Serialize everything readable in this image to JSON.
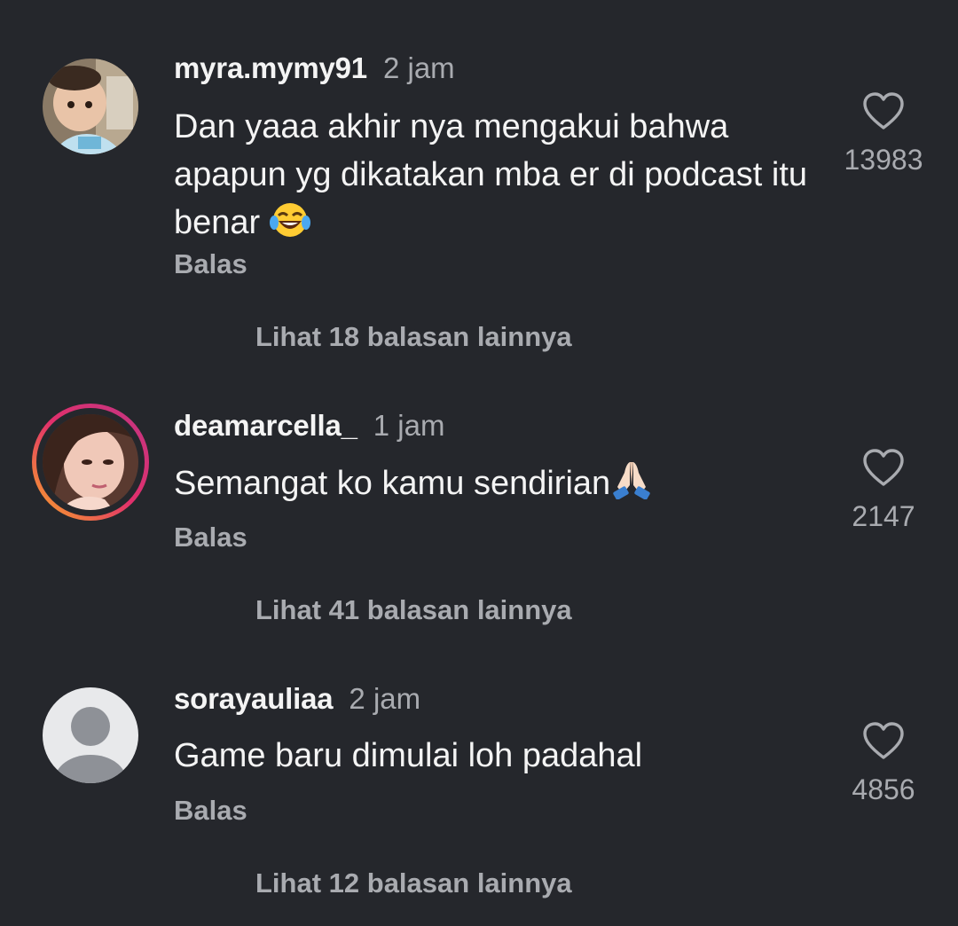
{
  "comments": [
    {
      "username": "myra.mymy91",
      "time": "2 jam",
      "text": "Dan yaaa akhir nya mengakui bahwa apapun yg dikatakan mba er di podcast itu benar",
      "emoji": "laughing-tears",
      "reply_label": "Balas",
      "likes": "13983",
      "more_replies": "Lihat 18 balasan lainnya"
    },
    {
      "username": "deamarcella_",
      "time": "1 jam",
      "text": "Semangat ko kamu sendirian",
      "emoji": "folded-hands",
      "reply_label": "Balas",
      "likes": "2147",
      "more_replies": "Lihat 41 balasan lainnya"
    },
    {
      "username": "sorayauliaa",
      "time": "2 jam",
      "text": "Game baru dimulai loh padahal",
      "reply_label": "Balas",
      "likes": "4856",
      "more_replies": "Lihat 12 balasan lainnya"
    }
  ],
  "colors": {
    "background": "#25272c",
    "primary_text": "#f4f4f4",
    "secondary_text": "#a9abb0",
    "story_ring_start": "#f9a826",
    "story_ring_end": "#c13584"
  }
}
